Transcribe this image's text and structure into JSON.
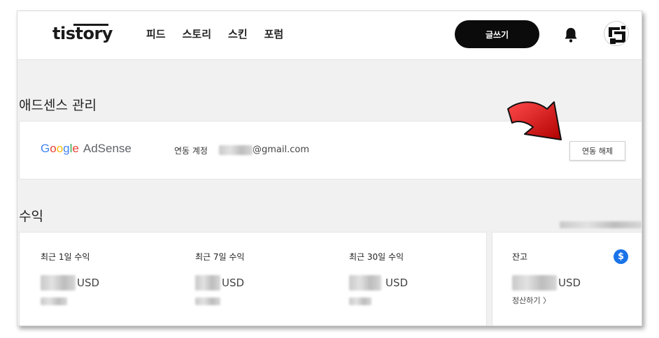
{
  "header": {
    "logo": "tistory",
    "nav": [
      "피드",
      "스토리",
      "스킨",
      "포럼"
    ],
    "write_button": "글쓰기",
    "icons": {
      "notifications": "bell-icon",
      "profile": "avatar"
    }
  },
  "adsense": {
    "section_title": "애드센스 관리",
    "brand_google": [
      "G",
      "o",
      "o",
      "g",
      "l",
      "e"
    ],
    "brand_product": "AdSense",
    "linked_label": "연동 계정",
    "email_suffix": "@gmail.com",
    "unlink_button": "연동 해제"
  },
  "revenue": {
    "section_title": "수익",
    "items": [
      {
        "label": "최근 1일 수익",
        "currency": "USD"
      },
      {
        "label": "최근 7일 수익",
        "currency": "USD"
      },
      {
        "label": "최근 30일 수익",
        "currency": "USD"
      }
    ],
    "balance": {
      "label": "잔고",
      "currency": "USD",
      "settle_link": "정산하기 〉",
      "icon": "dollar-icon"
    }
  },
  "colors": {
    "accent": "#1a73e8",
    "write_button_bg": "#0b0b0b",
    "arrow": "#e01010",
    "google_blue": "#4285f4",
    "google_red": "#ea4335",
    "google_yellow": "#fbbc05",
    "google_green": "#34a853"
  }
}
